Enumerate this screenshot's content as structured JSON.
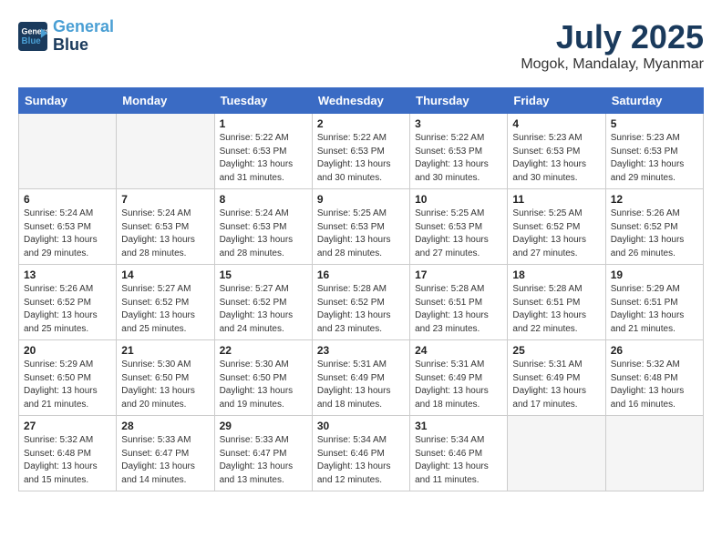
{
  "header": {
    "logo_line1": "General",
    "logo_line2": "Blue",
    "month_year": "July 2025",
    "location": "Mogok, Mandalay, Myanmar"
  },
  "weekdays": [
    "Sunday",
    "Monday",
    "Tuesday",
    "Wednesday",
    "Thursday",
    "Friday",
    "Saturday"
  ],
  "weeks": [
    [
      {
        "day": "",
        "info": ""
      },
      {
        "day": "",
        "info": ""
      },
      {
        "day": "1",
        "info": "Sunrise: 5:22 AM\nSunset: 6:53 PM\nDaylight: 13 hours\nand 31 minutes."
      },
      {
        "day": "2",
        "info": "Sunrise: 5:22 AM\nSunset: 6:53 PM\nDaylight: 13 hours\nand 30 minutes."
      },
      {
        "day": "3",
        "info": "Sunrise: 5:22 AM\nSunset: 6:53 PM\nDaylight: 13 hours\nand 30 minutes."
      },
      {
        "day": "4",
        "info": "Sunrise: 5:23 AM\nSunset: 6:53 PM\nDaylight: 13 hours\nand 30 minutes."
      },
      {
        "day": "5",
        "info": "Sunrise: 5:23 AM\nSunset: 6:53 PM\nDaylight: 13 hours\nand 29 minutes."
      }
    ],
    [
      {
        "day": "6",
        "info": "Sunrise: 5:24 AM\nSunset: 6:53 PM\nDaylight: 13 hours\nand 29 minutes."
      },
      {
        "day": "7",
        "info": "Sunrise: 5:24 AM\nSunset: 6:53 PM\nDaylight: 13 hours\nand 28 minutes."
      },
      {
        "day": "8",
        "info": "Sunrise: 5:24 AM\nSunset: 6:53 PM\nDaylight: 13 hours\nand 28 minutes."
      },
      {
        "day": "9",
        "info": "Sunrise: 5:25 AM\nSunset: 6:53 PM\nDaylight: 13 hours\nand 28 minutes."
      },
      {
        "day": "10",
        "info": "Sunrise: 5:25 AM\nSunset: 6:53 PM\nDaylight: 13 hours\nand 27 minutes."
      },
      {
        "day": "11",
        "info": "Sunrise: 5:25 AM\nSunset: 6:52 PM\nDaylight: 13 hours\nand 27 minutes."
      },
      {
        "day": "12",
        "info": "Sunrise: 5:26 AM\nSunset: 6:52 PM\nDaylight: 13 hours\nand 26 minutes."
      }
    ],
    [
      {
        "day": "13",
        "info": "Sunrise: 5:26 AM\nSunset: 6:52 PM\nDaylight: 13 hours\nand 25 minutes."
      },
      {
        "day": "14",
        "info": "Sunrise: 5:27 AM\nSunset: 6:52 PM\nDaylight: 13 hours\nand 25 minutes."
      },
      {
        "day": "15",
        "info": "Sunrise: 5:27 AM\nSunset: 6:52 PM\nDaylight: 13 hours\nand 24 minutes."
      },
      {
        "day": "16",
        "info": "Sunrise: 5:28 AM\nSunset: 6:52 PM\nDaylight: 13 hours\nand 23 minutes."
      },
      {
        "day": "17",
        "info": "Sunrise: 5:28 AM\nSunset: 6:51 PM\nDaylight: 13 hours\nand 23 minutes."
      },
      {
        "day": "18",
        "info": "Sunrise: 5:28 AM\nSunset: 6:51 PM\nDaylight: 13 hours\nand 22 minutes."
      },
      {
        "day": "19",
        "info": "Sunrise: 5:29 AM\nSunset: 6:51 PM\nDaylight: 13 hours\nand 21 minutes."
      }
    ],
    [
      {
        "day": "20",
        "info": "Sunrise: 5:29 AM\nSunset: 6:50 PM\nDaylight: 13 hours\nand 21 minutes."
      },
      {
        "day": "21",
        "info": "Sunrise: 5:30 AM\nSunset: 6:50 PM\nDaylight: 13 hours\nand 20 minutes."
      },
      {
        "day": "22",
        "info": "Sunrise: 5:30 AM\nSunset: 6:50 PM\nDaylight: 13 hours\nand 19 minutes."
      },
      {
        "day": "23",
        "info": "Sunrise: 5:31 AM\nSunset: 6:49 PM\nDaylight: 13 hours\nand 18 minutes."
      },
      {
        "day": "24",
        "info": "Sunrise: 5:31 AM\nSunset: 6:49 PM\nDaylight: 13 hours\nand 18 minutes."
      },
      {
        "day": "25",
        "info": "Sunrise: 5:31 AM\nSunset: 6:49 PM\nDaylight: 13 hours\nand 17 minutes."
      },
      {
        "day": "26",
        "info": "Sunrise: 5:32 AM\nSunset: 6:48 PM\nDaylight: 13 hours\nand 16 minutes."
      }
    ],
    [
      {
        "day": "27",
        "info": "Sunrise: 5:32 AM\nSunset: 6:48 PM\nDaylight: 13 hours\nand 15 minutes."
      },
      {
        "day": "28",
        "info": "Sunrise: 5:33 AM\nSunset: 6:47 PM\nDaylight: 13 hours\nand 14 minutes."
      },
      {
        "day": "29",
        "info": "Sunrise: 5:33 AM\nSunset: 6:47 PM\nDaylight: 13 hours\nand 13 minutes."
      },
      {
        "day": "30",
        "info": "Sunrise: 5:34 AM\nSunset: 6:46 PM\nDaylight: 13 hours\nand 12 minutes."
      },
      {
        "day": "31",
        "info": "Sunrise: 5:34 AM\nSunset: 6:46 PM\nDaylight: 13 hours\nand 11 minutes."
      },
      {
        "day": "",
        "info": ""
      },
      {
        "day": "",
        "info": ""
      }
    ]
  ]
}
